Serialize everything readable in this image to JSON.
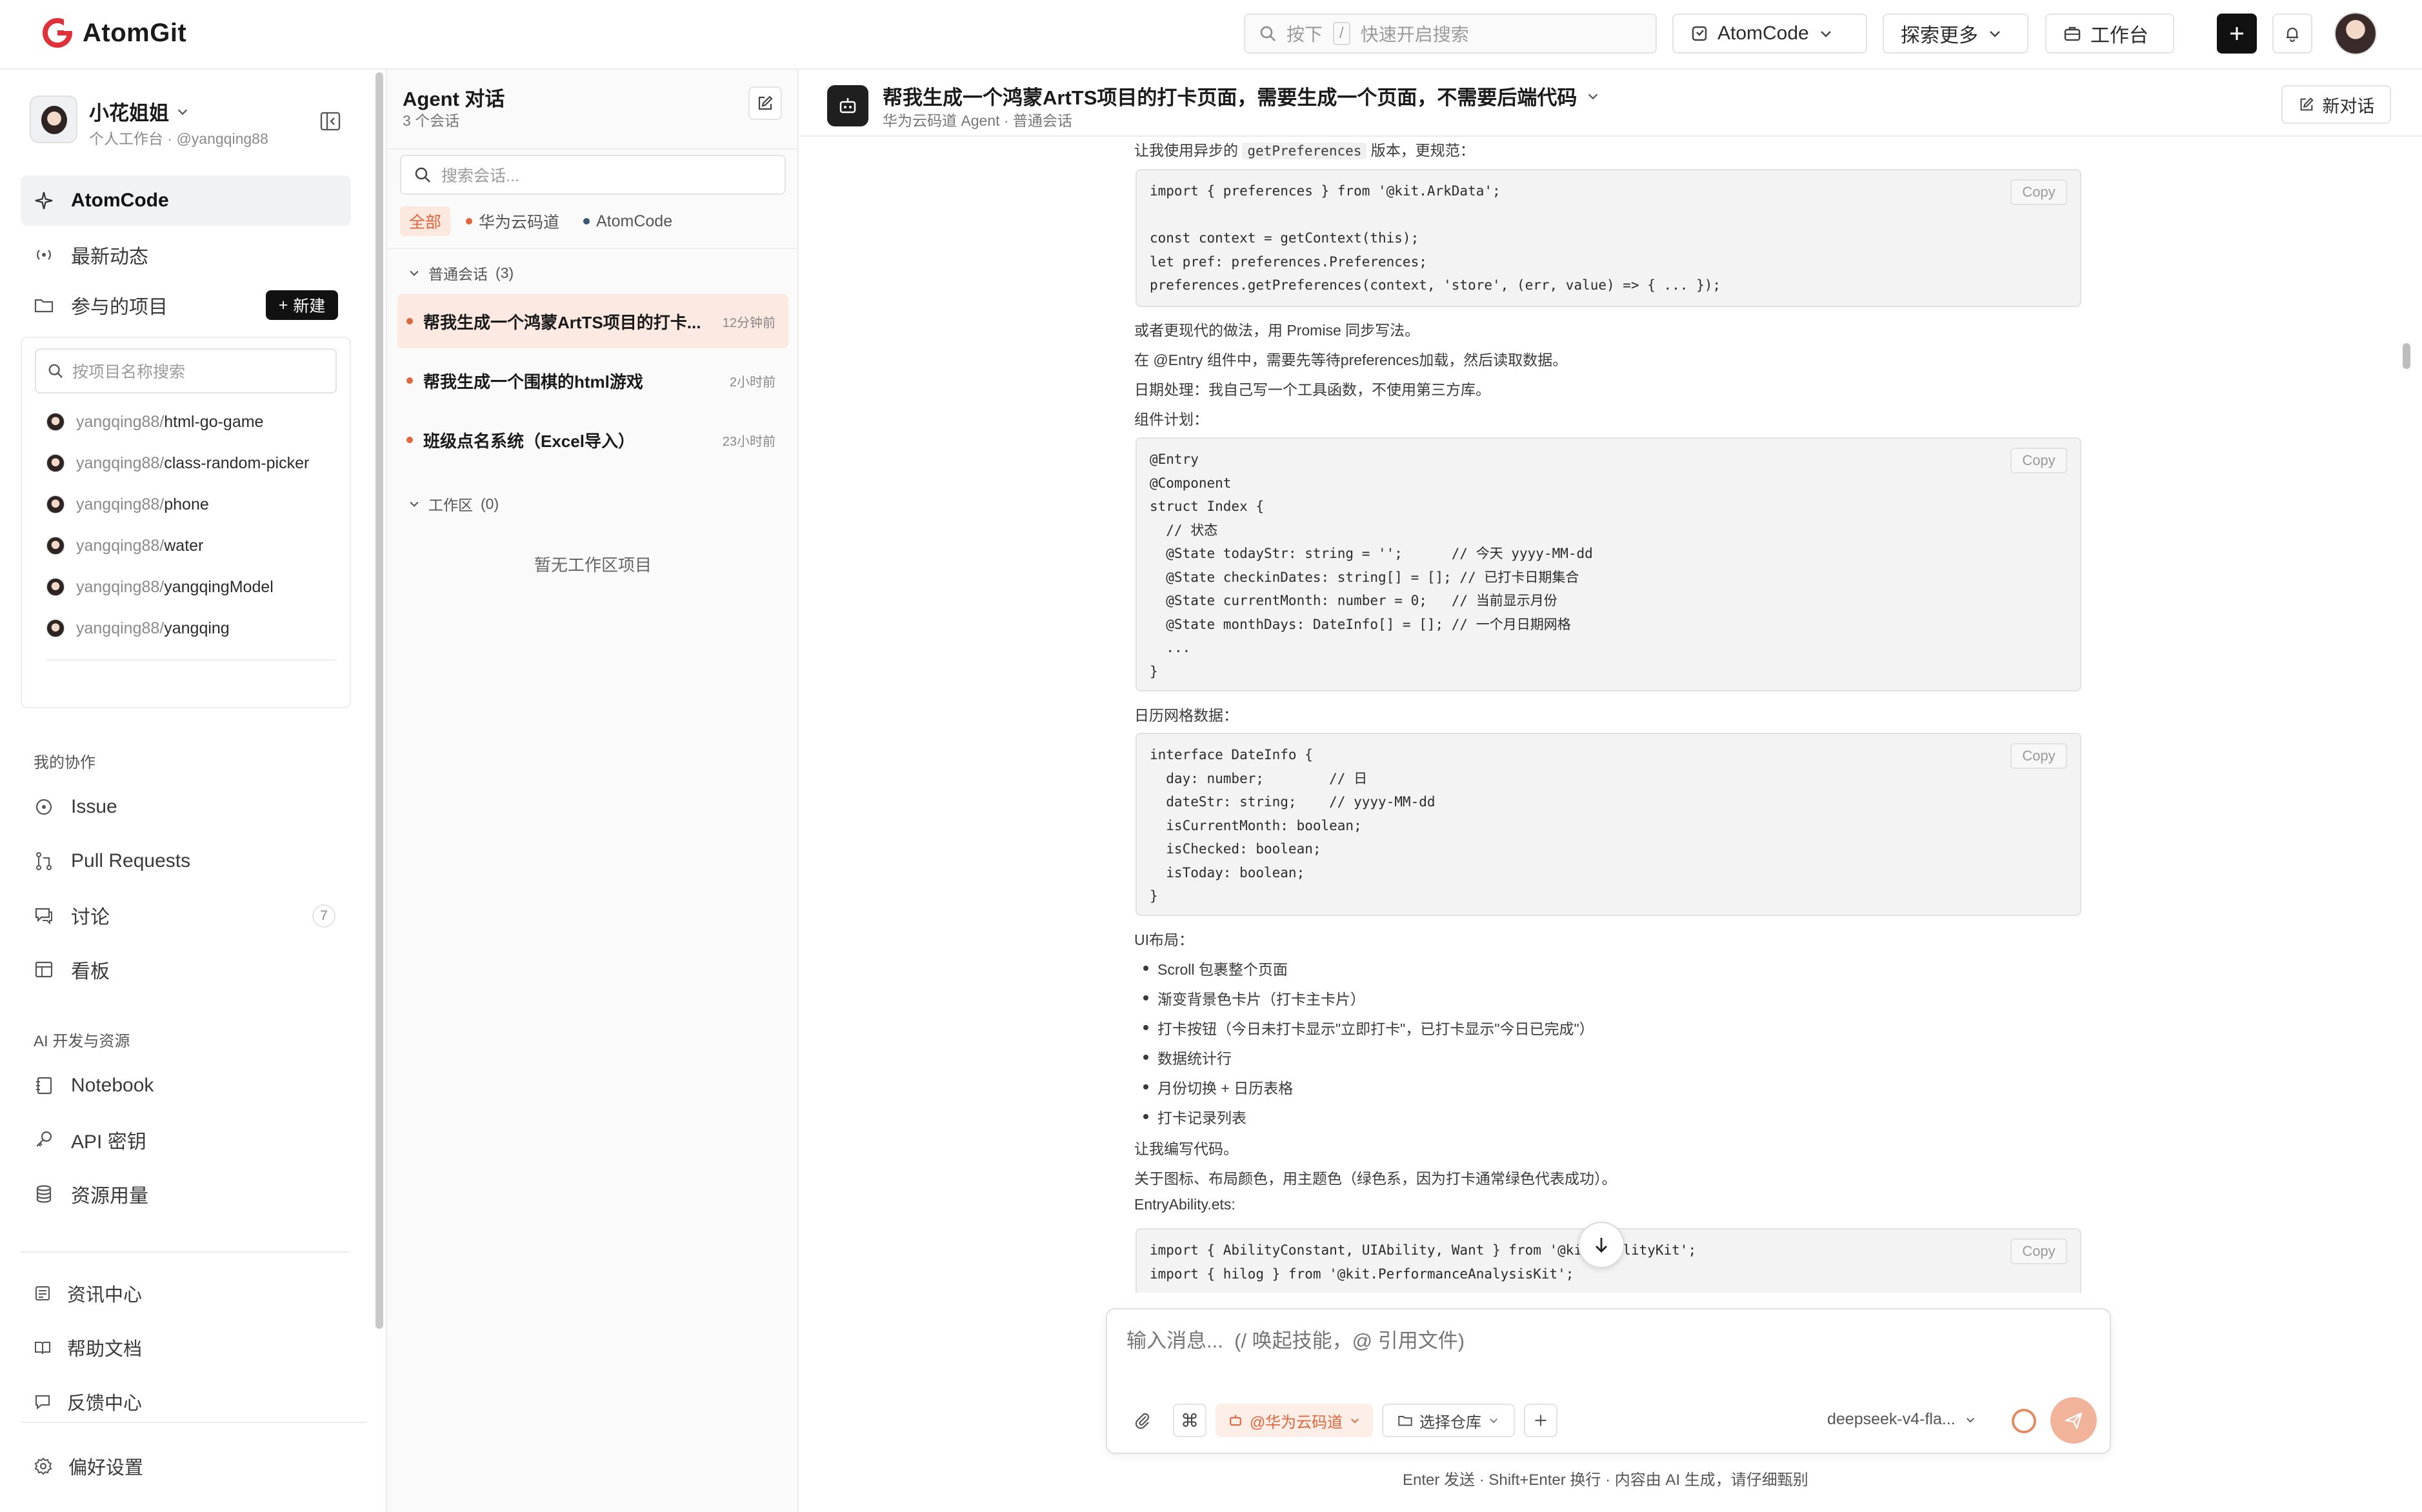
{
  "header": {
    "brand": "AtomGit",
    "search_key_hint_1": "按下",
    "search_key_hint_kbd": "/",
    "search_placeholder": "快速开启搜索",
    "atomcode_label": "AtomCode",
    "explore_label": "探索更多",
    "workbench_label": "工作台"
  },
  "sidebar": {
    "user_name": "小花姐姐",
    "user_sub": "个人工作台 · @yangqing88",
    "nav_atomcode": "AtomCode",
    "nav_activity": "最新动态",
    "nav_projects": "参与的项目",
    "new_button": "新建",
    "project_search_placeholder": "按项目名称搜索",
    "projects": [
      {
        "owner": "yangqing88/",
        "repo": "html-go-game"
      },
      {
        "owner": "yangqing88/",
        "repo": "class-random-picker"
      },
      {
        "owner": "yangqing88/",
        "repo": "phone"
      },
      {
        "owner": "yangqing88/",
        "repo": "water"
      },
      {
        "owner": "yangqing88/",
        "repo": "yangqingModel"
      },
      {
        "owner": "yangqing88/",
        "repo": "yangqing"
      }
    ],
    "section_collab": "我的协作",
    "nav_issue": "Issue",
    "nav_pr": "Pull Requests",
    "nav_discuss": "讨论",
    "discuss_count": "7",
    "nav_board": "看板",
    "section_ai": "AI 开发与资源",
    "nav_notebook": "Notebook",
    "nav_api": "API 密钥",
    "nav_usage": "资源用量",
    "nav_news": "资讯中心",
    "nav_help": "帮助文档",
    "nav_feedback": "反馈中心",
    "nav_pref": "偏好设置"
  },
  "conversations": {
    "title": "Agent 对话",
    "count": "3 个会话",
    "search_placeholder": "搜索会话...",
    "filters": {
      "all": "全部",
      "huawei": "华为云码道",
      "atomcode": "AtomCode"
    },
    "group_normal": "普通会话",
    "group_normal_count": "(3)",
    "group_work": "工作区",
    "group_work_count": "(0)",
    "items": [
      {
        "title": "帮我生成一个鸿蒙ArtTS项目的打卡...",
        "time": "12分钟前"
      },
      {
        "title": "帮我生成一个围棋的html游戏",
        "time": "2小时前"
      },
      {
        "title": "班级点名系统（Excel导入）",
        "time": "23小时前"
      }
    ],
    "empty_work": "暂无工作区项目"
  },
  "chat": {
    "title": "帮我生成一个鸿蒙ArtTS项目的打卡页面，需要生成一个页面，不需要后端代码",
    "subtitle": "华为云码道 Agent · 普通会话",
    "new_chat": "新对话",
    "copy_label": "Copy",
    "line_getpref_pre": "让我使用异步的",
    "line_getpref_code": "getPreferences",
    "line_getpref_post": "版本，更规范：",
    "code1": "import { preferences } from '@kit.ArkData';\n\nconst context = getContext(this);\nlet pref: preferences.Preferences;\npreferences.getPreferences(context, 'store', (err, value) => { ... });",
    "line_promise": "或者更现代的做法，用 Promise 同步写法。",
    "line_entry": "在 @Entry 组件中，需要先等待preferences加载，然后读取数据。",
    "line_date": "日期处理：我自己写一个工具函数，不使用第三方库。",
    "line_plan": "组件计划：",
    "code2": "@Entry\n@Component\nstruct Index {\n  // 状态\n  @State todayStr: string = '';      // 今天 yyyy-MM-dd\n  @State checkinDates: string[] = []; // 已打卡日期集合\n  @State currentMonth: number = 0;   // 当前显示月份\n  @State monthDays: DateInfo[] = []; // 一个月日期网格\n  ...\n}",
    "line_grid": "日历网格数据：",
    "code3": "interface DateInfo {\n  day: number;        // 日\n  dateStr: string;    // yyyy-MM-dd\n  isCurrentMonth: boolean;\n  isChecked: boolean;\n  isToday: boolean;\n}",
    "line_ui": "UI布局：",
    "bullets": [
      "Scroll 包裹整个页面",
      "渐变背景色卡片（打卡主卡片）",
      "打卡按钮（今日未打卡显示\"立即打卡\"，已打卡显示\"今日已完成\"）",
      "数据统计行",
      "月份切换 + 日历表格",
      "打卡记录列表"
    ],
    "line_write": "让我编写代码。",
    "line_color": "关于图标、布局颜色，用主题色（绿色系，因为打卡通常绿色代表成功）。",
    "line_entryability": "EntryAbility.ets:",
    "code4": "import { AbilityConstant, UIAbility, Want } from '@kit.AbilityKit';\nimport { hilog } from '@kit.PerformanceAnalysisKit';"
  },
  "composer": {
    "placeholder": "输入消息...  (/ 唤起技能，@ 引用文件)",
    "huawei_pill": "@华为云码道",
    "repo_label": "选择仓库",
    "model": "deepseek-v4-fla...",
    "hint": "Enter 发送 · Shift+Enter 换行 · 内容由 AI 生成，请仔细甄别"
  },
  "colors": {
    "accent": "#e0663c",
    "accent_soft": "#fde8df",
    "send_button": "#f1b49a",
    "dark": "#111111"
  }
}
